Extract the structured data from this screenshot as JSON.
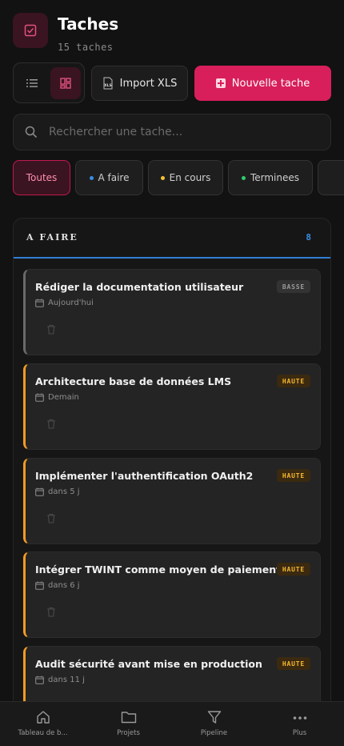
{
  "header": {
    "title": "Taches",
    "count_text": "15 taches"
  },
  "toolbar": {
    "import_label": "Import XLS",
    "import_icon_text": "XLS",
    "new_label": "Nouvelle tache"
  },
  "search": {
    "placeholder": "Rechercher une tache..."
  },
  "filters": [
    {
      "label": "Toutes",
      "active": true
    },
    {
      "label": "A faire",
      "dot_color": "#3a8de5"
    },
    {
      "label": "En cours",
      "dot_color": "#f5c132"
    },
    {
      "label": "Terminees",
      "dot_color": "#2ecc71"
    }
  ],
  "column": {
    "title": "A FAIRE",
    "count": "8",
    "accent": "#2f7fd6"
  },
  "tasks": [
    {
      "title": "Rédiger la documentation utilisateur",
      "priority": "BASSE",
      "due": "Aujourd'hui"
    },
    {
      "title": "Architecture base de données LMS",
      "priority": "HAUTE",
      "due": "Demain"
    },
    {
      "title": "Implémenter l'authentification OAuth2",
      "priority": "HAUTE",
      "due": "dans 5 j"
    },
    {
      "title": "Intégrer TWINT comme moyen de paiement",
      "priority": "HAUTE",
      "due": "dans 6 j"
    },
    {
      "title": "Audit sécurité avant mise en production",
      "priority": "HAUTE",
      "due": "dans 11 j"
    }
  ],
  "nav": [
    {
      "label": "Tableau de b...",
      "icon": "home-icon"
    },
    {
      "label": "Projets",
      "icon": "folder-icon"
    },
    {
      "label": "Pipeline",
      "icon": "filter-icon"
    },
    {
      "label": "Plus",
      "icon": "more-icon"
    }
  ],
  "colors": {
    "accent": "#d81f5b",
    "high_priority": "#f39c24",
    "background": "#121212"
  }
}
